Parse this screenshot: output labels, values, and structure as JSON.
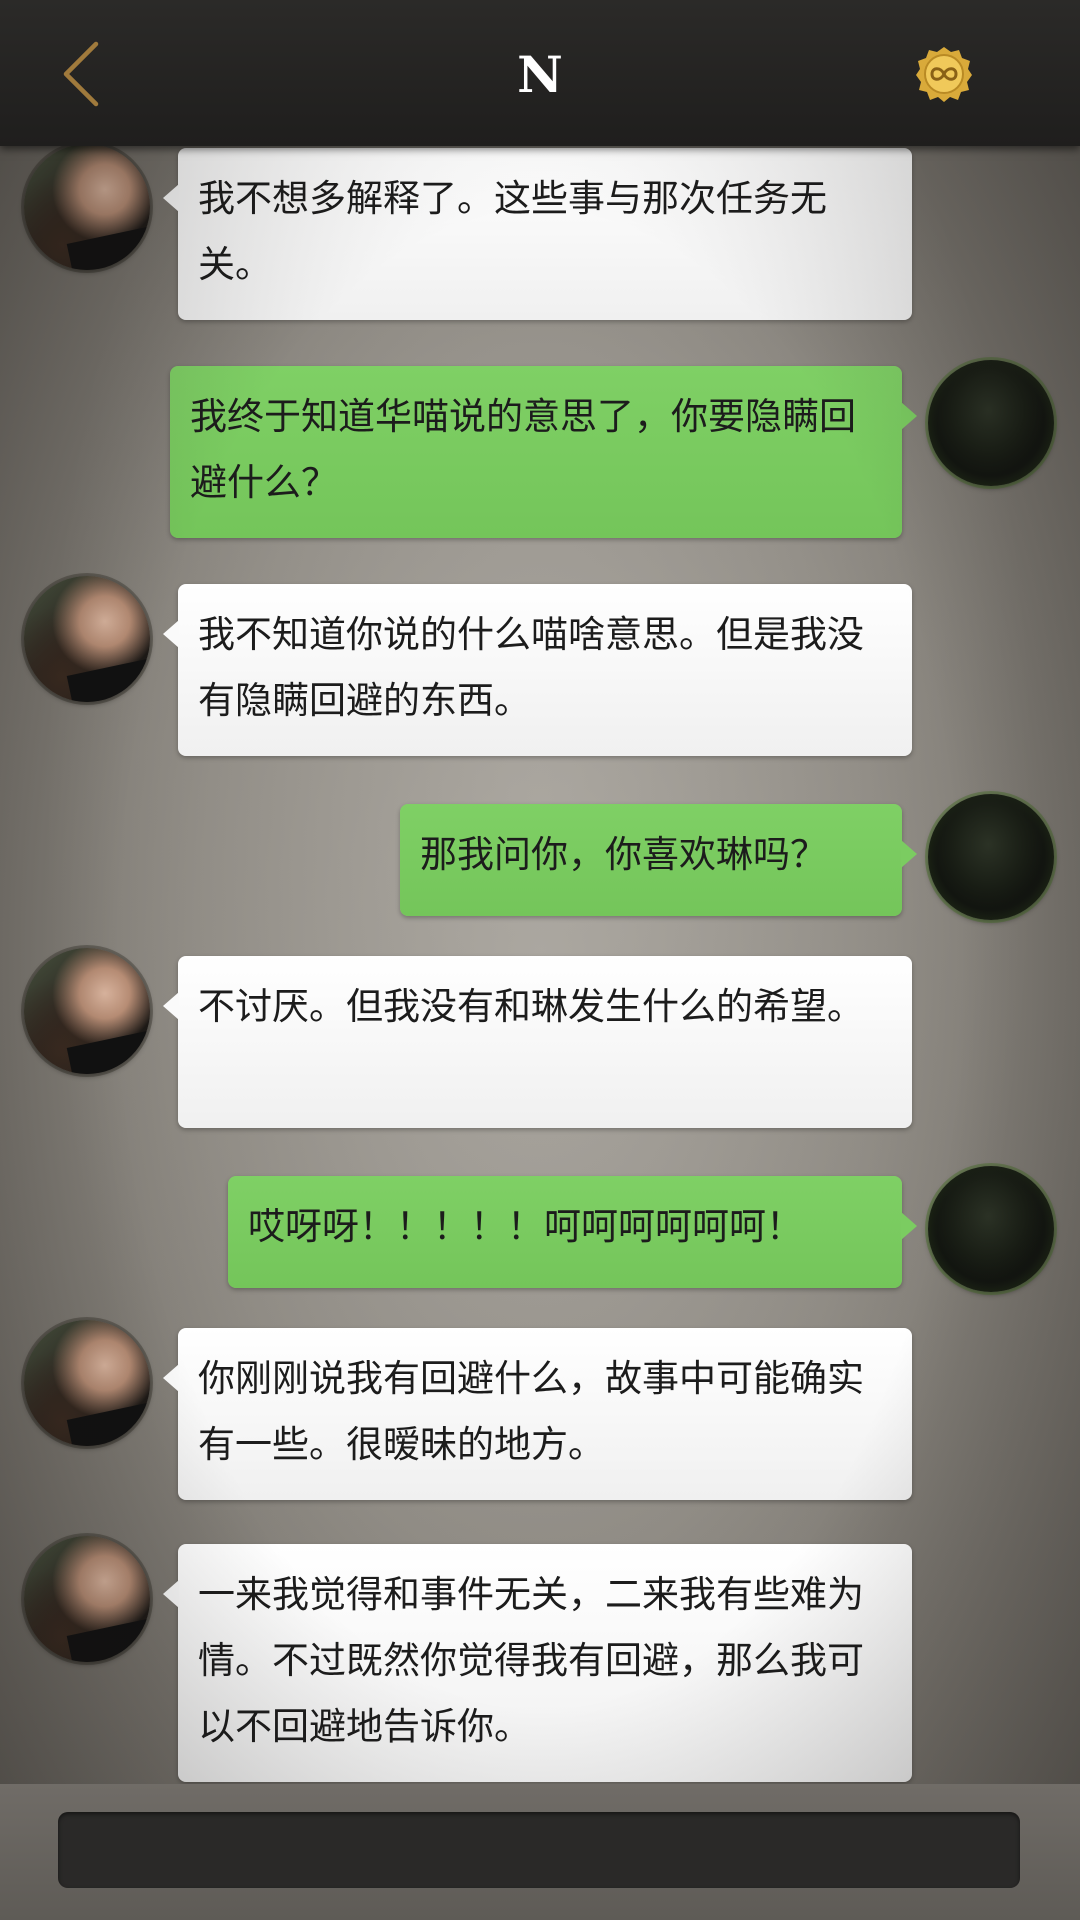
{
  "header": {
    "title": "N",
    "back_icon": "chevron-left-icon",
    "badge_icon": "infinity-badge-icon",
    "accent_color": "#a07a3c",
    "badge_color": "#e0b64a"
  },
  "messages": [
    {
      "side": "left",
      "text": "我不想多解释了。这些事与那次任务无关。"
    },
    {
      "side": "right",
      "text": "我终于知道华喵说的意思了，你要隐瞒回避什么？"
    },
    {
      "side": "left",
      "text": "我不知道你说的什么喵啥意思。但是我没有隐瞒回避的东西。"
    },
    {
      "side": "right",
      "text": "那我问你，你喜欢琳吗？"
    },
    {
      "side": "left",
      "text": "不讨厌。但我没有和琳发生什么的希望。"
    },
    {
      "side": "right",
      "text": "哎呀呀！！！！！呵呵呵呵呵呵！"
    },
    {
      "side": "left",
      "text": "你刚刚说我有回避什么，故事中可能确实有一些。很暧昧的地方。"
    },
    {
      "side": "left",
      "text": "一来我觉得和事件无关，二来我有些难为情。不过既然你觉得我有回避，那么我可以不回避地告诉你。"
    }
  ],
  "colors": {
    "outgoing_bubble": "#76c75c",
    "incoming_bubble": "#f5f5f5",
    "header_bg": "#242322"
  }
}
